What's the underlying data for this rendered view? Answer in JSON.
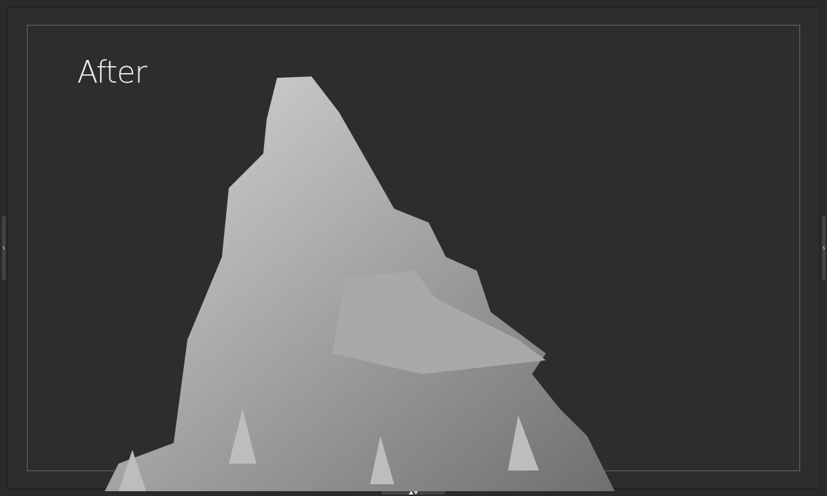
{
  "viewport": {
    "label": "After"
  }
}
